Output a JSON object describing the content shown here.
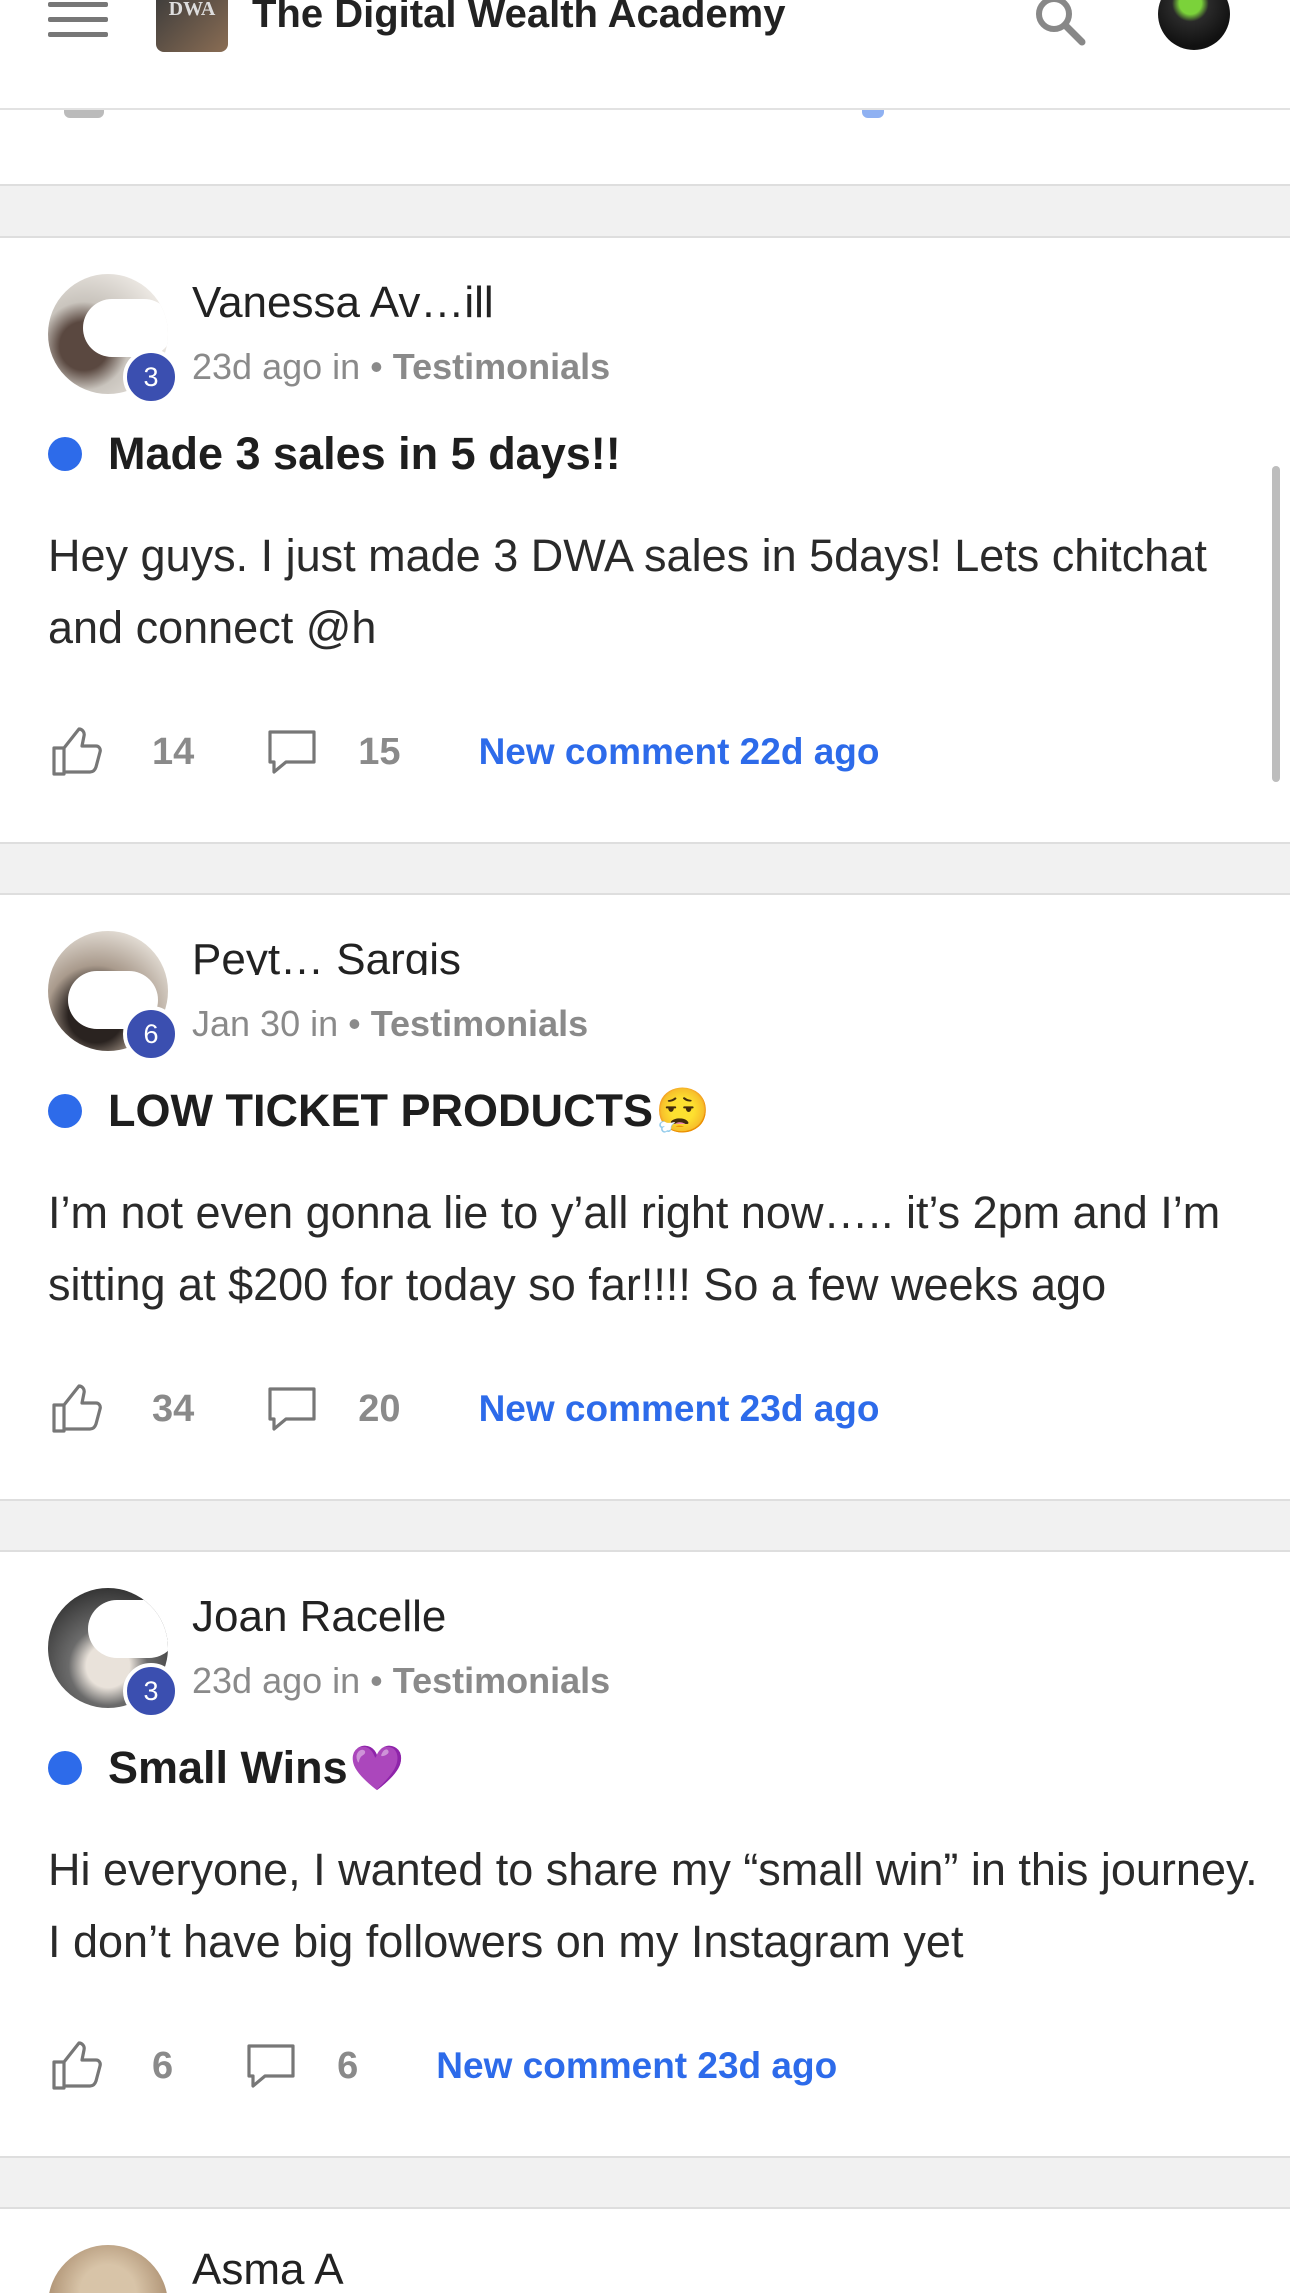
{
  "app": {
    "title": "The Digital Wealth Academy",
    "logo_text": "DWA"
  },
  "posts": [
    {
      "author": "Vanessa Av…ill",
      "level": "3",
      "time": "23d ago in",
      "category": "Testimonials",
      "title": "Made 3 sales in 5 days!!",
      "emoji": "",
      "body": "Hey guys. I just made 3 DWA sales in 5days! Lets chitchat and connect @h",
      "likes": "14",
      "comments": "15",
      "new_comment": "New comment 22d ago"
    },
    {
      "author": "Peyt… Sargis",
      "level": "6",
      "time": "Jan 30 in",
      "category": "Testimonials",
      "title": "LOW TICKET PRODUCTS",
      "emoji": "😮‍💨",
      "body": "I’m not even gonna lie to y’all right now….. it’s 2pm and I’m sitting at $200 for today so far!!!! So a few weeks ago",
      "likes": "34",
      "comments": "20",
      "new_comment": "New comment 23d ago"
    },
    {
      "author": "Joan Racelle",
      "level": "3",
      "time": "23d ago in",
      "category": "Testimonials",
      "title": "Small Wins",
      "emoji": "💜",
      "body": "Hi everyone, I wanted to share my “small win” in this journey. I don’t have big followers on my Instagram yet",
      "likes": "6",
      "comments": "6",
      "new_comment": "New comment 23d ago"
    },
    {
      "author": "Asma A"
    }
  ],
  "colors": {
    "accent": "#2d6bea",
    "badge": "#3b4fb0",
    "muted": "#8a8a8a"
  }
}
